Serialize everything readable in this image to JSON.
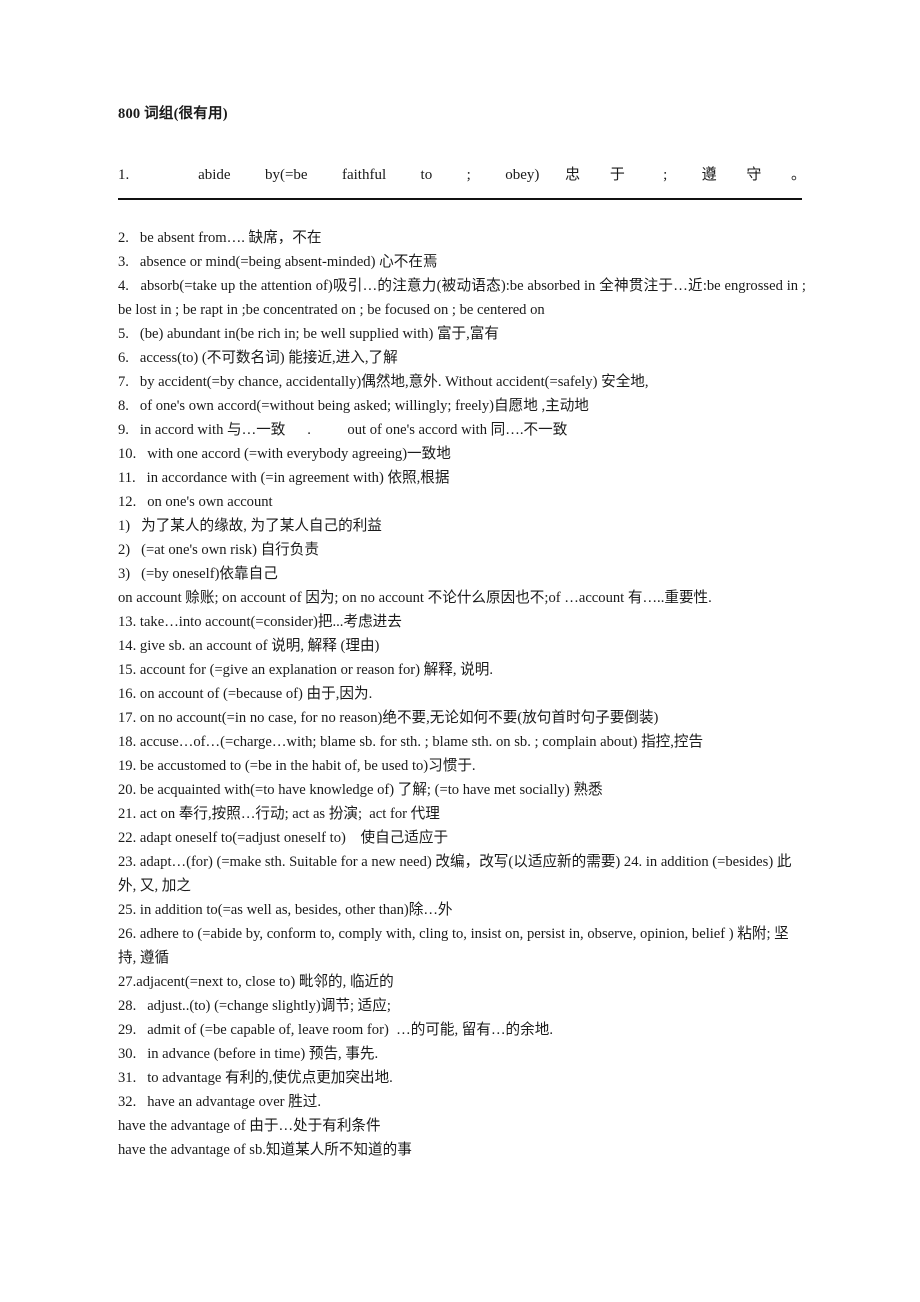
{
  "document": {
    "title": "800 词组(很有用)",
    "entry_one": "1.        abide    by(=be    faithful    to    ;    obey)   忠   于    ;    遵   守   。",
    "divider": "horizontal-rule",
    "entries": [
      "2.   be absent from…. 缺席，不在",
      "3.   absence or mind(=being absent-minded) 心不在焉",
      "4.   absorb(=take up the attention of)吸引…的注意力(被动语态):be absorbed in 全神贯注于…近:be engrossed in ; be lost in ; be rapt in ;be concentrated on ; be focused on ; be centered on",
      "5.   (be) abundant in(be rich in; be well supplied with) 富于,富有",
      "6.   access(to) (不可数名词) 能接近,进入,了解",
      "7.   by accident(=by chance, accidentally)偶然地,意外. Without accident(=safely) 安全地,",
      "8.   of one's own accord(=without being asked; willingly; freely)自愿地 ,主动地",
      "9.   in accord with 与…一致      .          out of one's accord with 同….不一致",
      "10.   with one accord (=with everybody agreeing)一致地",
      "11.   in accordance with (=in agreement with) 依照,根据",
      "12.   on one's own account",
      "1)   为了某人的缘故, 为了某人自己的利益",
      "2)   (=at one's own risk) 自行负责",
      "3)   (=by oneself)依靠自己",
      "on account 赊账; on account of 因为; on no account 不论什么原因也不;of …account 有…..重要性.",
      "13. take…into account(=consider)把...考虑进去",
      "14. give sb. an account of 说明, 解释 (理由)",
      "15. account for (=give an explanation or reason for) 解释, 说明.",
      "16. on account of (=because of) 由于,因为.",
      "17. on no account(=in no case, for no reason)绝不要,无论如何不要(放句首时句子要倒装)",
      "18. accuse…of…(=charge…with; blame sb. for sth. ; blame sth. on sb. ; complain about) 指控,控告",
      "19. be accustomed to (=be in the habit of, be used to)习惯于.",
      "20. be acquainted with(=to have knowledge of) 了解; (=to have met socially) 熟悉",
      "21. act on 奉行,按照…行动; act as 扮演;  act for 代理",
      "22. adapt oneself to(=adjust oneself to)    使自己适应于",
      "23. adapt…(for) (=make sth. Suitable for a new need) 改编，改写(以适应新的需要) 24. in addition (=besides) 此外, 又, 加之",
      "25. in addition to(=as well as, besides, other than)除…外",
      "26. adhere to (=abide by, conform to, comply with, cling to, insist on, persist in, observe, opinion, belief ) 粘附; 坚持, 遵循",
      "27.adjacent(=next to, close to) 毗邻的, 临近的",
      "28.   adjust..(to) (=change slightly)调节; 适应;",
      "29.   admit of (=be capable of, leave room for)  …的可能, 留有…的余地.",
      "30.   in advance (before in time) 预告, 事先.",
      "31.   to advantage 有利的,使优点更加突出地.",
      "32.   have an advantage over 胜过.",
      "have the advantage of 由于…处于有利条件",
      "have the advantage of sb.知道某人所不知道的事"
    ]
  }
}
